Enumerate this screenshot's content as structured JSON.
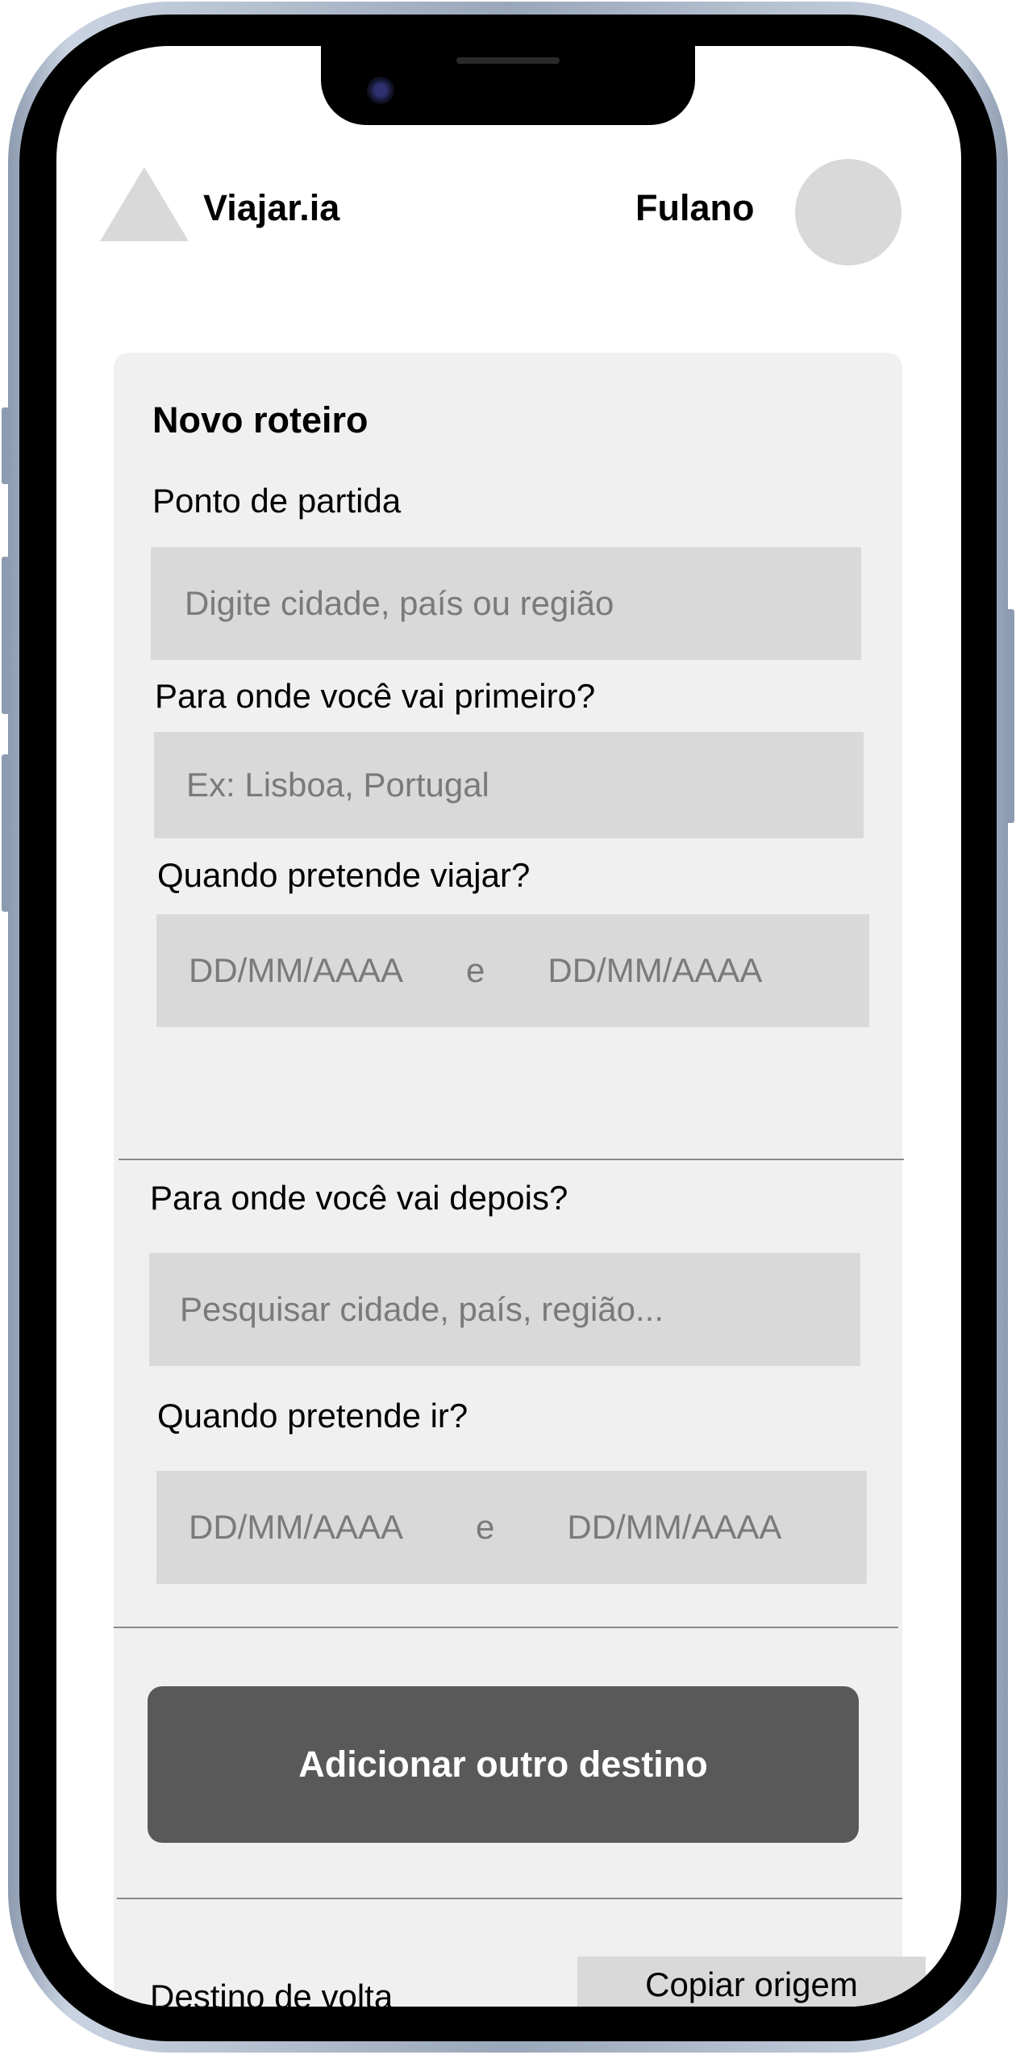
{
  "header": {
    "brand": "Viajar.ia",
    "user_name": "Fulano"
  },
  "form": {
    "title": "Novo roteiro",
    "origin": {
      "label": "Ponto de partida",
      "placeholder": "Digite cidade, país ou região"
    },
    "first_destination": {
      "label": "Para onde você vai primeiro?",
      "placeholder": "Ex: Lisboa, Portugal",
      "dates_label": "Quando pretende viajar?",
      "start_placeholder": "DD/MM/AAAA",
      "connector": "e",
      "end_placeholder": "DD/MM/AAAA"
    },
    "next_destination": {
      "label": "Para onde você vai depois?",
      "placeholder": "Pesquisar cidade, país, região...",
      "dates_label": "Quando pretende ir?",
      "start_placeholder": "DD/MM/AAAA",
      "connector": "e",
      "end_placeholder": "DD/MM/AAAA"
    },
    "add_destination_button": "Adicionar outro destino",
    "return": {
      "label": "Destino de volta",
      "copy_button": "Copiar origem"
    }
  },
  "icons": {
    "logo": "triangle-logo-icon",
    "avatar": "user-avatar-circle"
  },
  "colors": {
    "card_background": "#f0f0f0",
    "input_background": "#d9d9d9",
    "placeholder_text": "#7a7a7a",
    "primary_button": "#595959"
  }
}
